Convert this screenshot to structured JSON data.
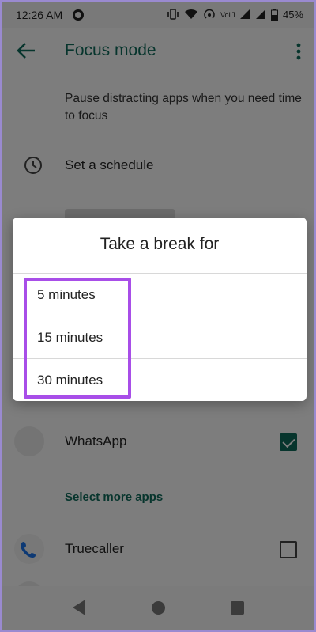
{
  "status_bar": {
    "time": "12:26 AM",
    "battery": "45%"
  },
  "app_bar": {
    "title": "Focus mode",
    "back_icon": "arrow-left-icon",
    "menu_icon": "more-vert-icon"
  },
  "description": "Pause distracting apps when you need time to focus",
  "schedule": {
    "label": "Set a schedule",
    "icon": "clock-icon"
  },
  "apps": [
    {
      "name": "WhatsApp",
      "checked": true,
      "icon": "whatsapp-icon"
    },
    {
      "name": "Truecaller",
      "checked": false,
      "icon": "phone-icon"
    }
  ],
  "select_more": "Select more apps",
  "dialog": {
    "title": "Take a break for",
    "options": [
      "5 minutes",
      "15 minutes",
      "30 minutes"
    ]
  },
  "colors": {
    "accent": "#0f6b5b",
    "highlight": "#a84ee8",
    "scrim": "rgba(0,0,0,0.5)"
  }
}
